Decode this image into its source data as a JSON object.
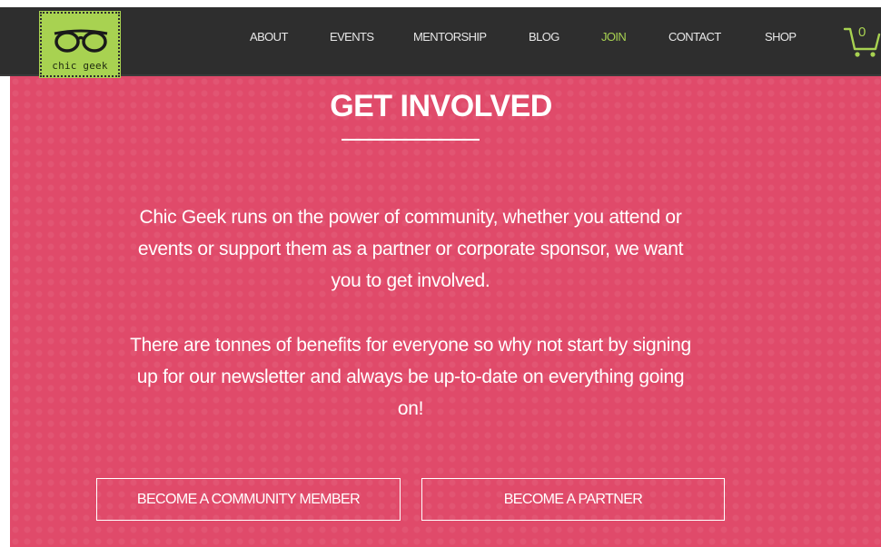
{
  "logo": {
    "text": "chic geek",
    "icon": "glasses-icon"
  },
  "nav": {
    "items": [
      {
        "label": "ABOUT"
      },
      {
        "label": "EVENTS"
      },
      {
        "label": "MENTORSHIP"
      },
      {
        "label": "BLOG"
      },
      {
        "label": "JOIN",
        "active": true
      },
      {
        "label": "CONTACT"
      },
      {
        "label": "SHOP"
      }
    ],
    "cart_count": "0",
    "cart_icon": "shopping-cart-icon"
  },
  "hero": {
    "title": "GET INVOLVED",
    "paragraph_1": "Chic Geek runs on the power of community, whether you attend or events or support them as a partner or corporate sponsor, we want you to get involved.",
    "paragraph_2": "There are tonnes of benefits for everyone so why not start by signing up for our newsletter and always be up-to-date on everything going on!",
    "buttons": {
      "community": "BECOME A COMMUNITY MEMBER",
      "partner": "BECOME A PARTNER"
    }
  },
  "colors": {
    "header_bg": "#2e2e2e",
    "accent_green": "#a8d251",
    "hero_pink": "#e04a6a",
    "text_white": "#ffffff"
  }
}
